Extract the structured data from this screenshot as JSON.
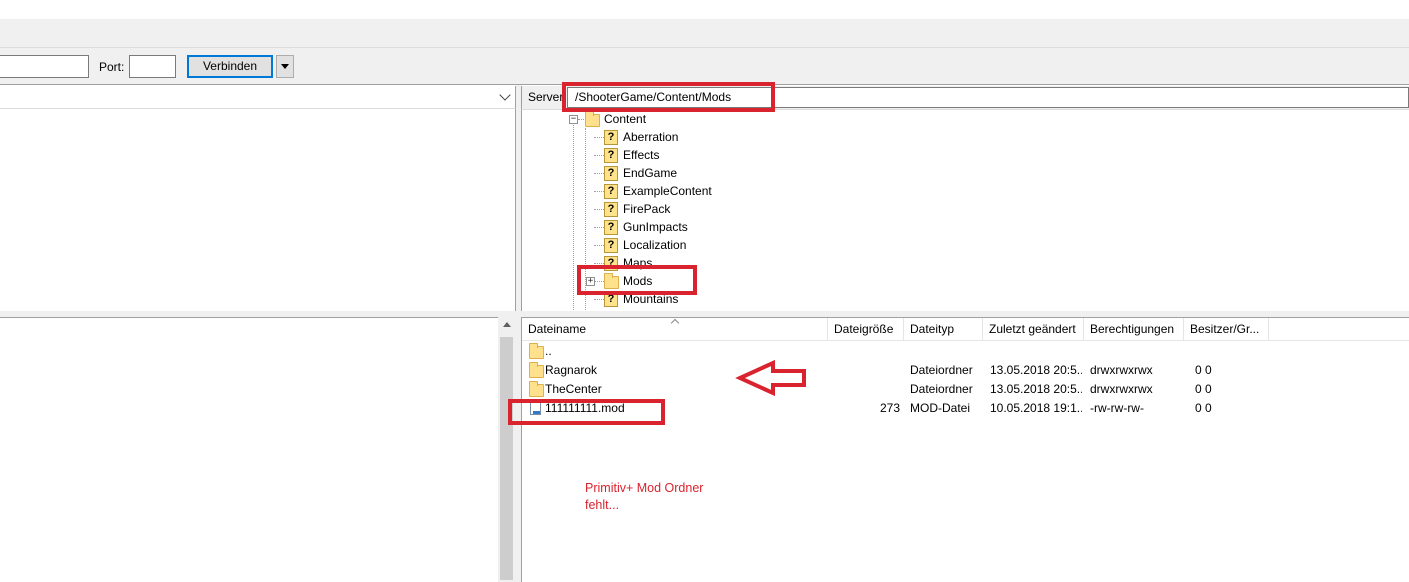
{
  "quickconnect": {
    "port_label": "Port:",
    "port_value": "",
    "connect_label": "Verbinden",
    "dropdown_icon": "triangle-down-icon"
  },
  "remote": {
    "path_label": "Server:",
    "path_value": "/ShooterGame/Content/Mods",
    "tree": [
      {
        "label": "Content",
        "type": "folder",
        "expander": "−"
      },
      {
        "label": "Aberration",
        "type": "unknown"
      },
      {
        "label": "Effects",
        "type": "unknown"
      },
      {
        "label": "EndGame",
        "type": "unknown"
      },
      {
        "label": "ExampleContent",
        "type": "unknown"
      },
      {
        "label": "FirePack",
        "type": "unknown"
      },
      {
        "label": "GunImpacts",
        "type": "unknown"
      },
      {
        "label": "Localization",
        "type": "unknown"
      },
      {
        "label": "Maps",
        "type": "unknown"
      },
      {
        "label": "Mods",
        "type": "folder",
        "expander": "+"
      },
      {
        "label": "Mountains",
        "type": "unknown"
      }
    ],
    "columns": [
      "Dateiname",
      "Dateigröße",
      "Dateityp",
      "Zuletzt geändert",
      "Berechtigungen",
      "Besitzer/Gr..."
    ],
    "files": [
      {
        "name": "..",
        "size": "",
        "type": "",
        "modified": "",
        "perms": "",
        "owner": "",
        "icon": "folder-icon"
      },
      {
        "name": "Ragnarok",
        "size": "",
        "type": "Dateiordner",
        "modified": "13.05.2018 20:5...",
        "perms": "drwxrwxrwx",
        "owner": "0 0",
        "icon": "folder-icon"
      },
      {
        "name": "TheCenter",
        "size": "",
        "type": "Dateiordner",
        "modified": "13.05.2018 20:5...",
        "perms": "drwxrwxrwx",
        "owner": "0 0",
        "icon": "folder-icon"
      },
      {
        "name": "111111111.mod",
        "size": "273",
        "type": "MOD-Datei",
        "modified": "10.05.2018 19:1...",
        "perms": "-rw-rw-rw-",
        "owner": "0 0",
        "icon": "file-icon"
      }
    ]
  },
  "annotation": {
    "note_line1": "Primitiv+ Mod Ordner",
    "note_line2": "fehlt...",
    "color": "#d9232e"
  }
}
